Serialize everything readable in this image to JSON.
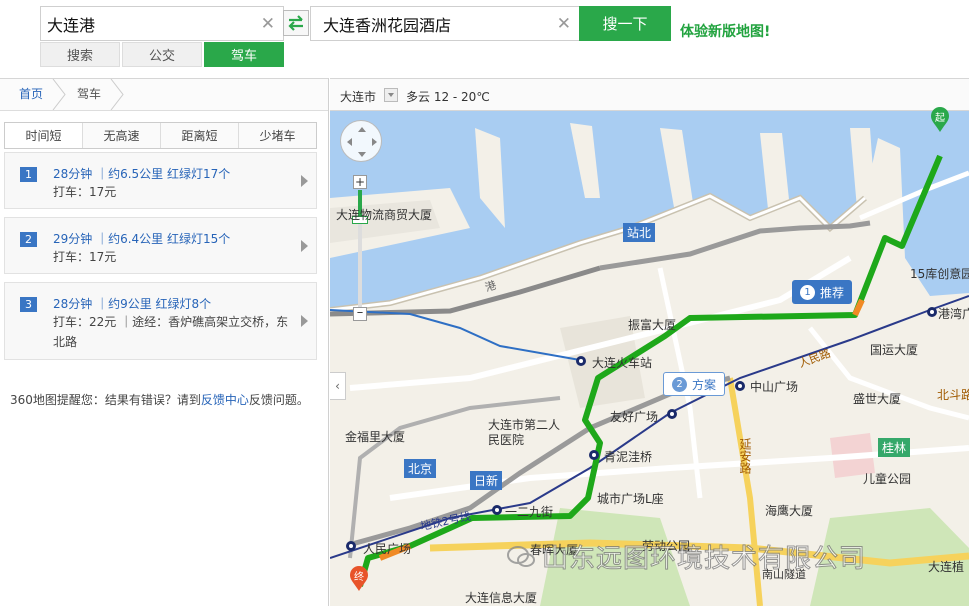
{
  "search": {
    "from_value": "大连港",
    "to_value": "大连香洲花园酒店",
    "button_label": "搜一下",
    "promo_text": "体验新版地图!"
  },
  "mode_tabs": [
    "搜索",
    "公交",
    "驾车"
  ],
  "breadcrumb": {
    "home": "首页",
    "current": "驾车"
  },
  "option_tabs": [
    "时间短",
    "无高速",
    "距离短",
    "少堵车"
  ],
  "routes": [
    {
      "num": "1",
      "title": "28分钟 ｜约6.5公里 红绿灯17个",
      "detail": "打车：17元"
    },
    {
      "num": "2",
      "title": "29分钟 ｜约6.4公里 红绿灯15个",
      "detail": "打车：17元"
    },
    {
      "num": "3",
      "title": "28分钟 ｜约9公里 红绿灯8个",
      "detail": "打车：22元 ｜途经：香炉礁高架立交桥，东北路"
    }
  ],
  "feedback": {
    "prefix": "360地图提醒您：结果有错误？请到",
    "link": "反馈中心",
    "suffix": "反馈问题。"
  },
  "map": {
    "city": "大连市",
    "weather": "多云 12 - 20℃",
    "route_markers": {
      "recommend_num": "1",
      "recommend_label": "推荐",
      "plan_num": "2",
      "plan_label": "方案",
      "start_glyph": "起",
      "end_glyph": "终"
    },
    "places": {
      "logistics": "大连物流商贸大厦",
      "station_north": "站北",
      "zhenfu": "振富大厦",
      "train_station": "大连火车站",
      "youhao": "友好广场",
      "zhongshan": "中山广场",
      "gangwan": "港湾广",
      "guoyuan": "国运大厦",
      "shengshi": "盛世大厦",
      "ku15": "15库创意园",
      "hospital": "大连市第二人民医院",
      "jinfuli": "金福里大厦",
      "qingniwaqiao": "青泥洼桥",
      "beijing": "北京",
      "rixin": "日新",
      "yi_er_jiu": "一二九街",
      "city_square": "城市广场L座",
      "haiying": "海鹰大厦",
      "guilin": "桂林",
      "ertong": "儿童公园",
      "beidou": "北斗路",
      "yanan": "延安路",
      "renmin_road": "人民路",
      "renmin_square": "人民广场",
      "chunhui": "春晖大厦",
      "laodong": "劳动公园",
      "info_building": "大连信息大厦",
      "nanshan_tunnel": "南山隧道",
      "metro2": "地铁2号线",
      "dalian_zhi": "大连植",
      "gang": "港"
    },
    "watermark": "山东远图环境技术有限公司"
  },
  "colors": {
    "green": "#2aa84a",
    "blue_link": "#2764b8",
    "route_green": "#1ea81a",
    "water": "#a9cdf2"
  }
}
